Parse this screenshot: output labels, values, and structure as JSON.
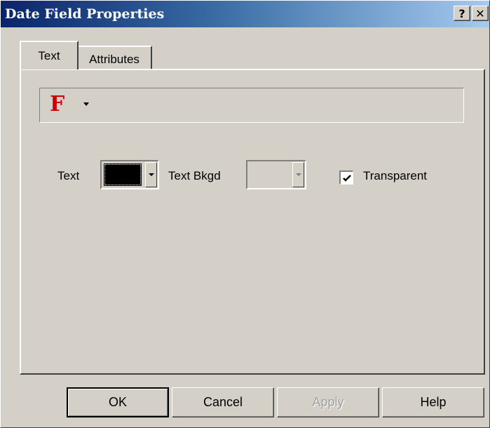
{
  "window": {
    "title": "Date Field Properties",
    "help_label": "?",
    "close_label": "✕"
  },
  "tabs": [
    {
      "label": "Text",
      "selected": true
    },
    {
      "label": "Attributes",
      "selected": false
    }
  ],
  "font_bar": {
    "icon_glyph": "F",
    "icon_name": "font-icon",
    "icon_color": "#cc0000"
  },
  "colors": {
    "text_label": "Text",
    "text_color": "#000000",
    "bkgd_label": "Text Bkgd",
    "bkgd_enabled": false,
    "transparent_label": "Transparent",
    "transparent_checked": true
  },
  "buttons": {
    "ok": "OK",
    "cancel": "Cancel",
    "apply": "Apply",
    "help": "Help"
  }
}
